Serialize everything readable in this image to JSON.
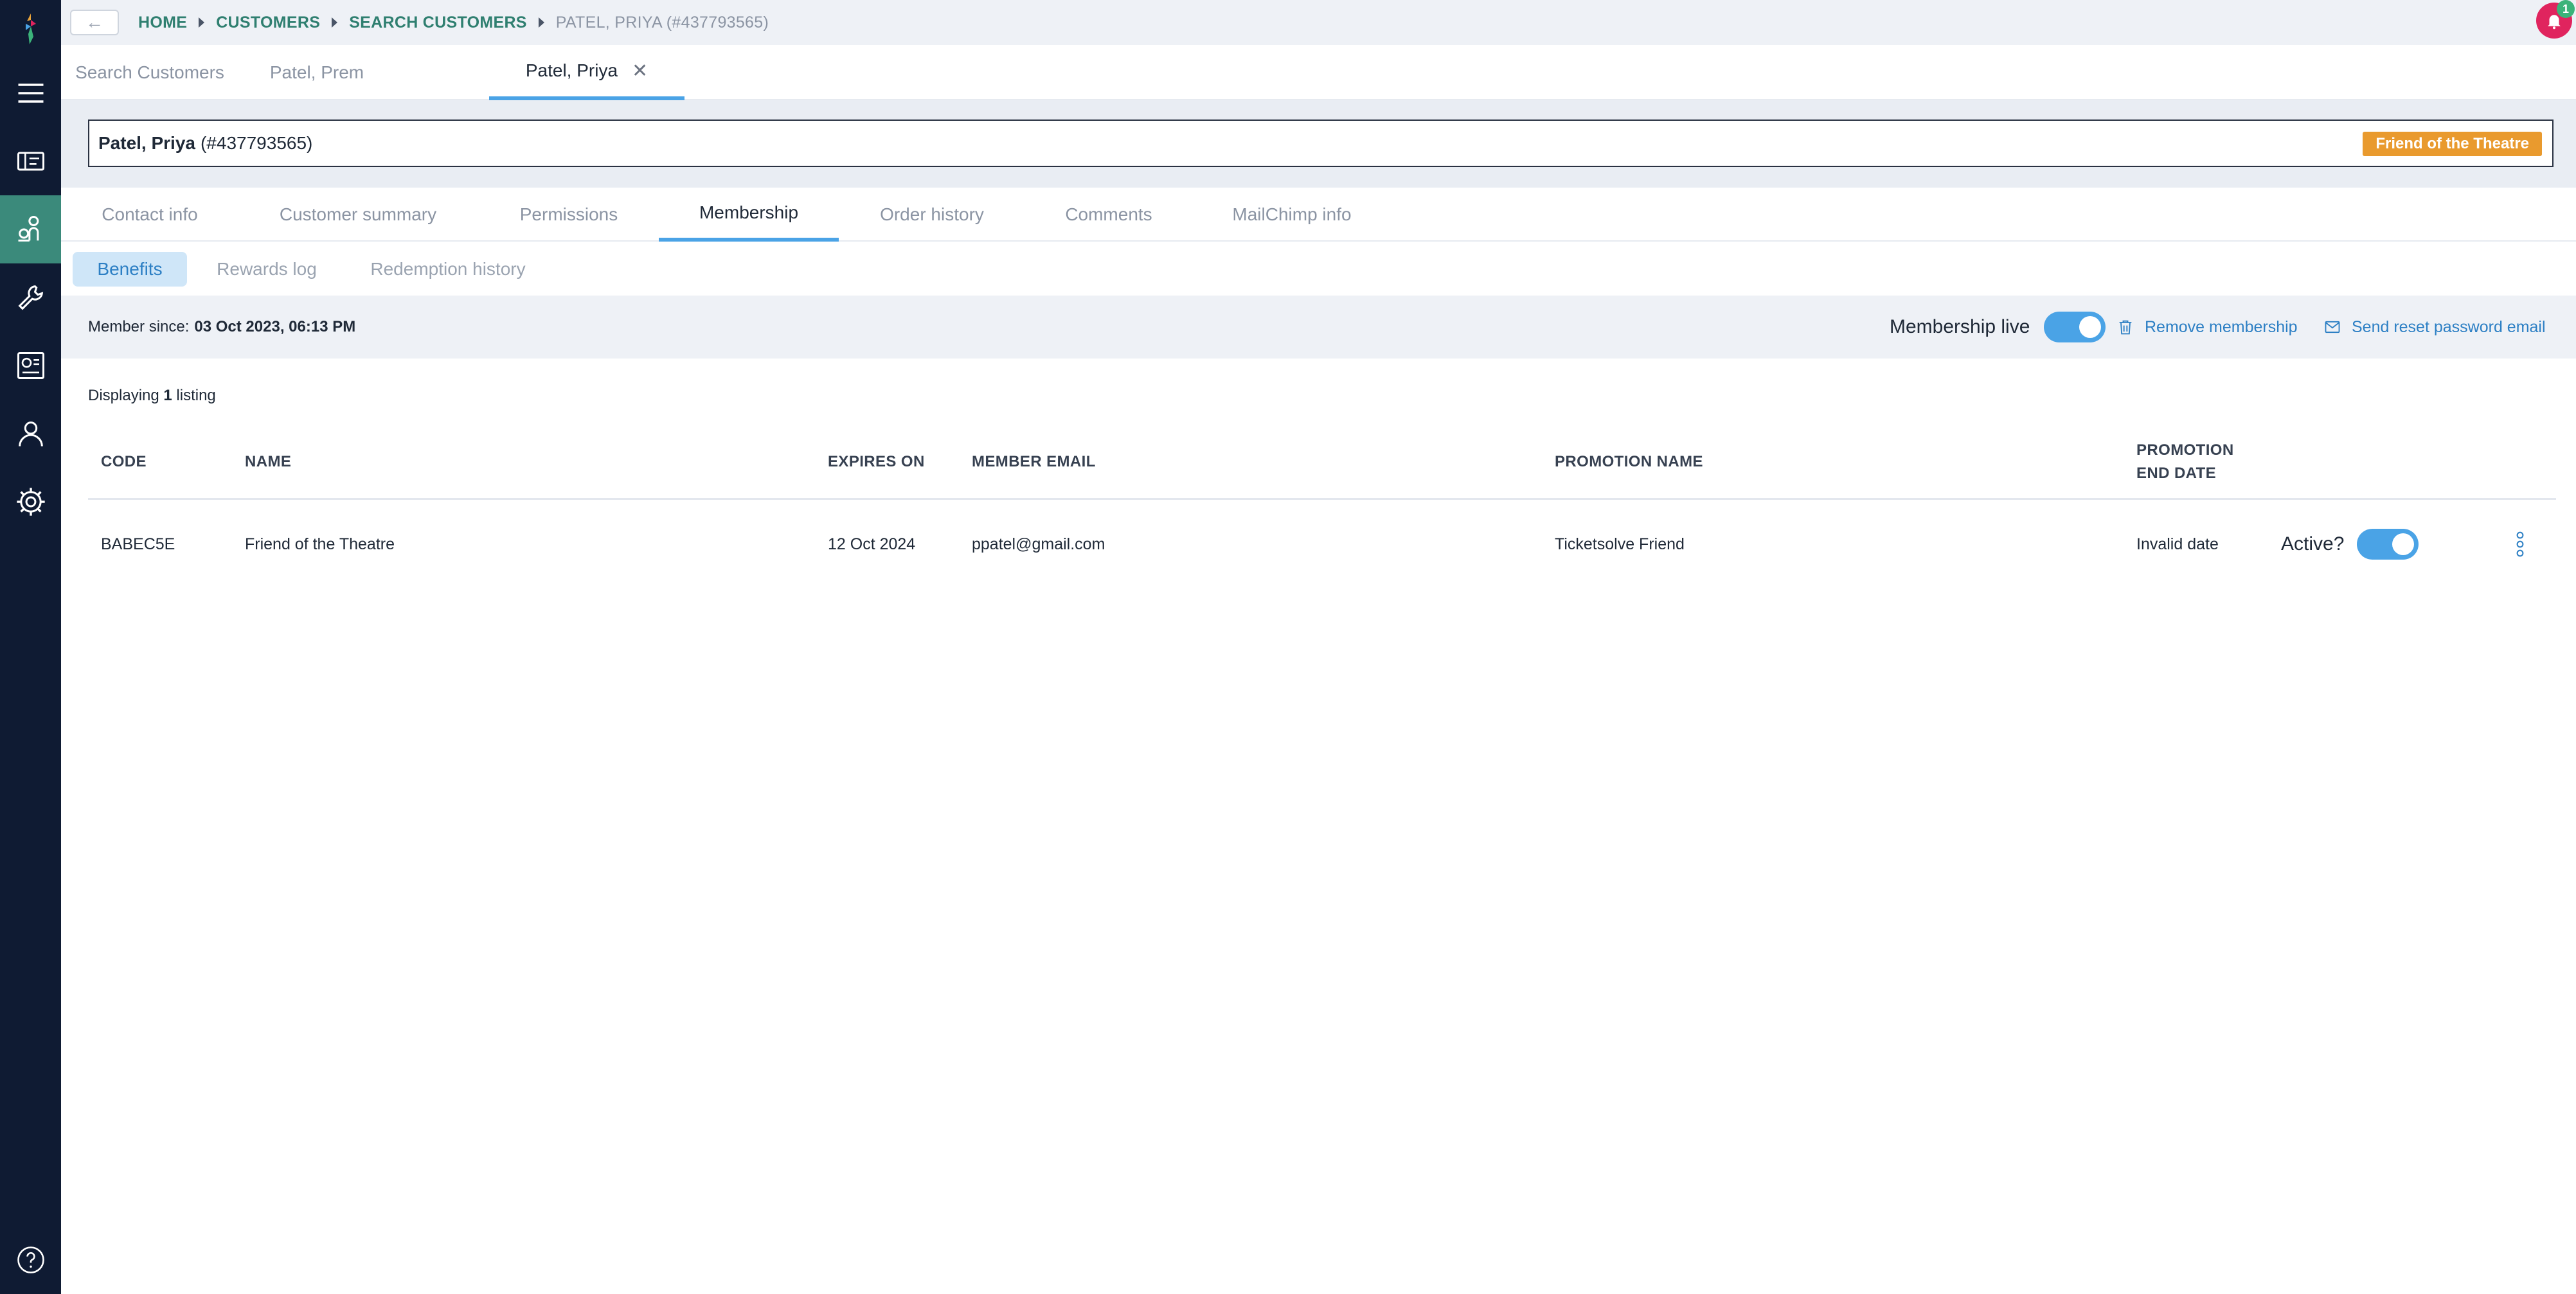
{
  "breadcrumb": {
    "items": [
      "HOME",
      "CUSTOMERS",
      "SEARCH CUSTOMERS"
    ],
    "current": "PATEL, PRIYA (#437793565)"
  },
  "notifications": {
    "count": "1"
  },
  "customer_tabs": [
    {
      "label": "Search Customers"
    },
    {
      "label": "Patel, Prem"
    },
    {
      "label": "Patel, Priya"
    }
  ],
  "customer": {
    "name": "Patel, Priya",
    "id_text": "(#437793565)",
    "badge": "Friend of the Theatre"
  },
  "section_tabs": [
    {
      "label": "Contact info"
    },
    {
      "label": "Customer summary"
    },
    {
      "label": "Permissions"
    },
    {
      "label": "Membership"
    },
    {
      "label": "Order history"
    },
    {
      "label": "Comments"
    },
    {
      "label": "MailChimp info"
    }
  ],
  "sub_tabs": [
    {
      "label": "Benefits"
    },
    {
      "label": "Rewards log"
    },
    {
      "label": "Redemption history"
    }
  ],
  "membership": {
    "since_label": "Member since:",
    "since_value": "03 Oct 2023, 06:13 PM",
    "live_label": "Membership live",
    "live": true,
    "remove_label": "Remove membership",
    "reset_label": "Send reset password email"
  },
  "listing": {
    "prefix": "Displaying",
    "count": "1",
    "suffix": "listing"
  },
  "table": {
    "headers": {
      "code": "CODE",
      "name": "NAME",
      "expires": "EXPIRES ON",
      "email": "MEMBER EMAIL",
      "promo": "PROMOTION NAME",
      "promo_end_1": "PROMOTION",
      "promo_end_2": "END DATE"
    },
    "rows": [
      {
        "code": "BABEC5E",
        "name": "Friend of the Theatre",
        "expires": "12 Oct 2024",
        "email": "ppatel@gmail.com",
        "promo": "Ticketsolve Friend",
        "promo_end": "Invalid date",
        "active_label": "Active?",
        "active": true
      }
    ]
  },
  "colors": {
    "rail": "#0f1b33",
    "rail_active": "#3b8a7b",
    "accent": "#4aa3e6",
    "link": "#2c7fc4",
    "breadcrumb": "#2f7f70",
    "badge": "#e99a2e",
    "notification": "#e0245e"
  }
}
